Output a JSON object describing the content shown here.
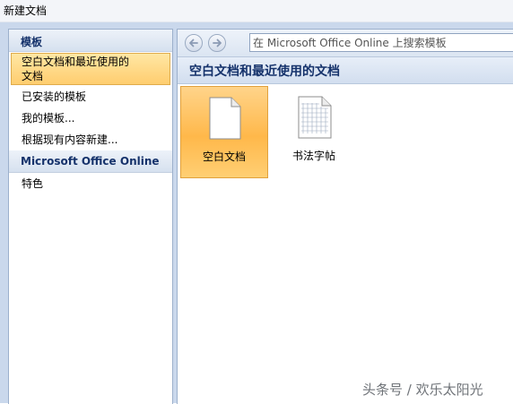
{
  "window": {
    "title": "新建文档"
  },
  "sidebar": {
    "templates_header": "模板",
    "items": [
      {
        "label": "空白文档和最近使用的文档",
        "selected": true
      },
      {
        "label": "已安装的模板"
      },
      {
        "label": "我的模板..."
      },
      {
        "label": "根据现有内容新建..."
      }
    ],
    "online_header": "Microsoft Office Online",
    "online_items": [
      {
        "label": "特色"
      }
    ]
  },
  "toolbar": {
    "back_icon": "arrow-left-icon",
    "forward_icon": "arrow-right-icon",
    "search_placeholder": "在 Microsoft Office Online 上搜索模板"
  },
  "main": {
    "header": "空白文档和最近使用的文档",
    "templates": [
      {
        "label": "空白文档",
        "icon": "blank-document-icon",
        "selected": true
      },
      {
        "label": "书法字帖",
        "icon": "calligraphy-grid-document-icon"
      }
    ]
  },
  "watermark": "头条号 / 欢乐太阳光",
  "colors": {
    "selection": "#ffcd6f",
    "header_text": "#15326b",
    "frame": "#cad8ec"
  }
}
